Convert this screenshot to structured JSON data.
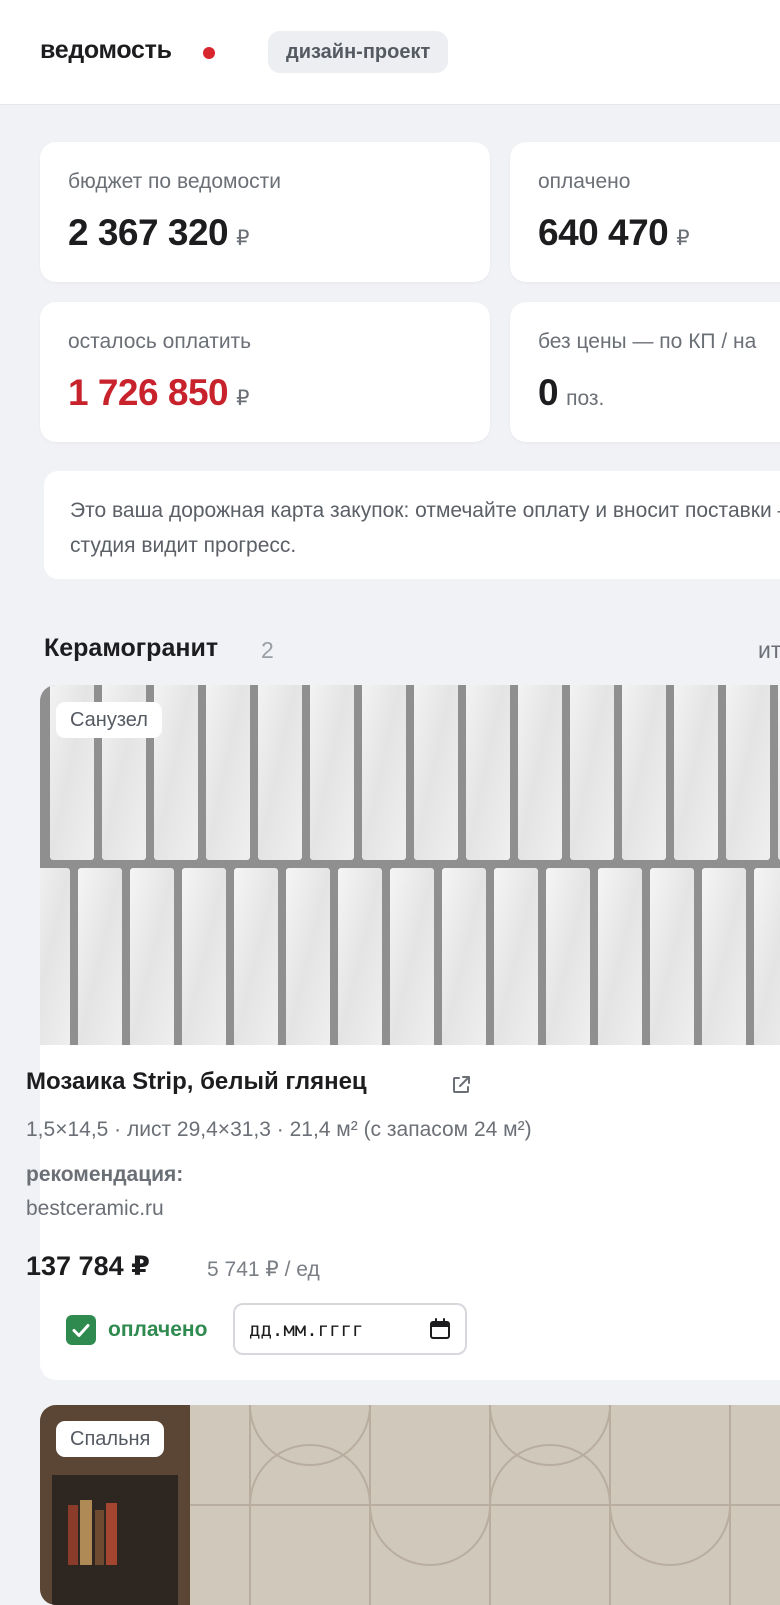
{
  "header": {
    "title": "ведомость",
    "tag": "дизайн-проект"
  },
  "stats": [
    {
      "label": "бюджет по ведомости",
      "value": "2 367 320",
      "unit": "₽"
    },
    {
      "label": "оплачено",
      "value": "640 470",
      "unit": "₽"
    },
    {
      "label": "осталось оплатить",
      "value": "1 726 850",
      "unit": "₽"
    },
    {
      "label": "без цены — по КП / на",
      "value": "0",
      "unit": "поз."
    }
  ],
  "note": {
    "text": "Это ваша дорожная карта закупок: отмечайте оплату и вносит поставки — студия видит прогресс."
  },
  "section": {
    "title": "Керамогранит",
    "count": "2",
    "right_text": "ит"
  },
  "items": [
    {
      "room": "Санузел",
      "image_icon": "mosaic-tile-photo",
      "title": "Мозаика Strip, белый глянец",
      "link_icon": "external-link-icon",
      "specs": "1,5×14,5 · лист 29,4×31,3 · 21,4 м² (с запасом 24 м²)",
      "recommendation_label": "рекомендация:",
      "recommendation_source": "bestceramic.ru",
      "price": "137 784 ₽",
      "unit_price": "5 741 ₽ / ед",
      "paid": true,
      "paid_label": "оплачено",
      "date_placeholder": "дд.мм.гггг"
    },
    {
      "room": "Спальня",
      "image_icon": "bedroom-wall-panels-photo"
    }
  ],
  "colors": {
    "accent_red": "#d8262f",
    "paid_green": "#2f8a4f",
    "background": "#f1f2f5"
  }
}
